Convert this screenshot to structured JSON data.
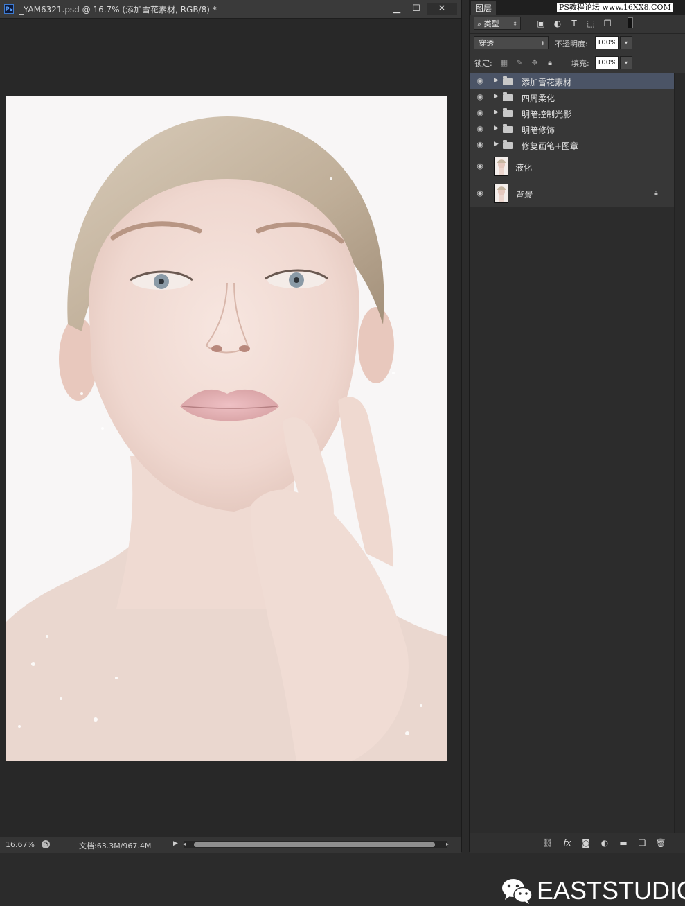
{
  "document": {
    "title": "_YAM6321.psd @ 16.7% (添加雪花素材, RGB/8) *",
    "logo": "Ps",
    "window_buttons": {
      "minimize": "▁",
      "maximize": "☐",
      "close": "✕"
    }
  },
  "status_bar": {
    "zoom": "16.67%",
    "doc_size": "文档:63.3M/967.4M",
    "arrow": "▶"
  },
  "layers_panel": {
    "tab": "图层",
    "watermark_top": "PS教程论坛 www.16XX8.COM",
    "filter": {
      "label": "类型",
      "prefix_icon": "⌕"
    },
    "filter_icons": [
      "image-filter-icon",
      "adjustment-filter-icon",
      "type-filter-icon",
      "shape-filter-icon",
      "smart-object-filter-icon"
    ],
    "blend_mode": "穿透",
    "opacity_label": "不透明度:",
    "opacity_value": "100%",
    "lock_label": "锁定:",
    "fill_label": "填充:",
    "fill_value": "100%",
    "layers": [
      {
        "name": "添加雪花素材",
        "type": "group",
        "selected": true
      },
      {
        "name": "四周柔化",
        "type": "group",
        "selected": false
      },
      {
        "name": "明暗控制光影",
        "type": "group",
        "selected": false
      },
      {
        "name": "明暗修饰",
        "type": "group",
        "selected": false
      },
      {
        "name": "修复画笔+图章",
        "type": "group",
        "selected": false
      },
      {
        "name": "液化",
        "type": "pixel",
        "selected": false
      },
      {
        "name": "背景",
        "type": "background",
        "selected": false,
        "locked": true
      }
    ],
    "brand": "EASTSTUDIO"
  },
  "colors": {
    "panel_bg": "#2e2e2e",
    "selected_layer": "#4b5466",
    "canvas_bg": "#282828"
  }
}
